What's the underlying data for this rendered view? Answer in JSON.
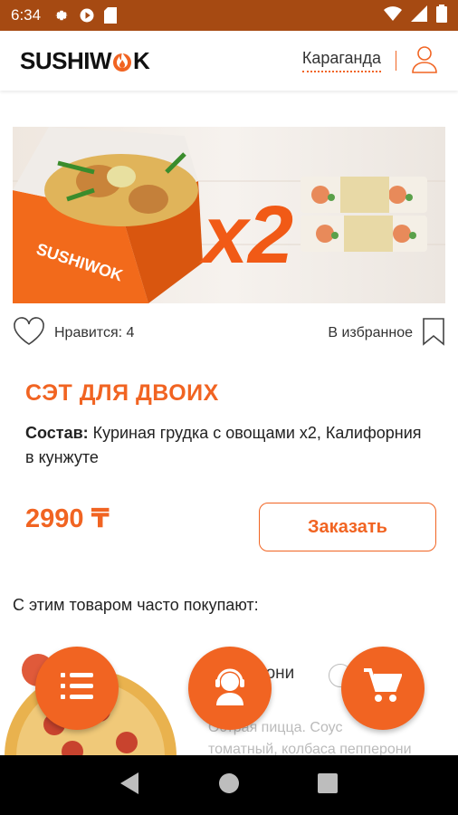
{
  "status_bar": {
    "time": "6:34",
    "icons": [
      "gear-icon",
      "play-icon",
      "sd-card-icon"
    ],
    "right_icons": [
      "wifi-icon",
      "signal-icon",
      "battery-icon"
    ]
  },
  "header": {
    "logo_text": "SUSHIW",
    "logo_text_end": "K",
    "city": "Караганда",
    "profile_icon": "user-icon"
  },
  "product": {
    "banner_multiplier": "x2",
    "banner_box_text": "SUSHIWOK",
    "likes_label": "Нравится: 4",
    "favorite_label": "В избранное",
    "title": "СЭТ ДЛЯ ДВОИХ",
    "composition_label": "Состав:",
    "composition_text": " Куриная грудка с овощами х2, Калифорния в кунжуте",
    "price": "2990 ₸",
    "order_button": "Заказать"
  },
  "recommendations": {
    "title": "С этим товаром часто покупают:",
    "item_name_partial": "рони",
    "item_desc_partial_1": "Острая пицца. Соус",
    "item_desc_partial_2": "томатный, колбаса пепперони"
  },
  "fabs": {
    "menu_icon": "menu-list-icon",
    "support_icon": "support-operator-icon",
    "cart_icon": "cart-icon"
  },
  "colors": {
    "accent": "#f16422",
    "status_bar": "#a64a12"
  }
}
